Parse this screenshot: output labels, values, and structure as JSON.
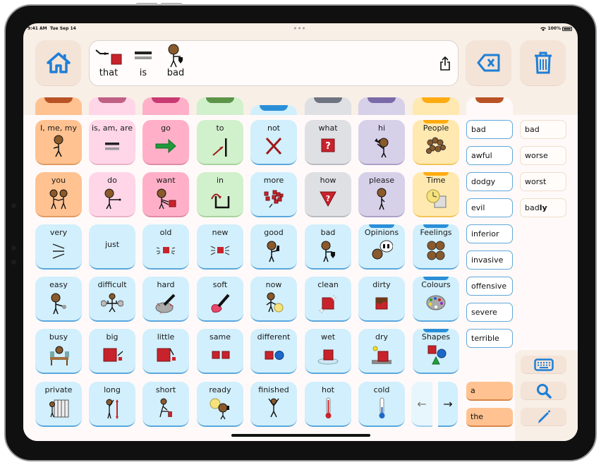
{
  "status_bar": {
    "time": "9:41 AM",
    "date": "Tue Sep 14",
    "dots": "•••",
    "wifi_icon": "wifi-icon",
    "battery": "100%"
  },
  "toolbar": {
    "home_icon": "home-icon",
    "share_icon": "share-icon",
    "backspace_icon": "backspace-icon",
    "clear_icon": "trash-icon"
  },
  "message": {
    "words": [
      {
        "label": "that",
        "symbol": "pointing-hand-square"
      },
      {
        "label": "is",
        "symbol": "equals"
      },
      {
        "label": "bad",
        "symbol": "person-thumbs-down"
      }
    ]
  },
  "colors": {
    "accent": "#1e7fd6",
    "tab_notches": [
      "#b95325",
      "#c06085",
      "#c93a72",
      "#5c9448",
      "#2b8fd8",
      "#6f7480",
      "#7a6aa8",
      "#ffab10",
      "#b95325"
    ],
    "tab_fills": [
      "#ffc290",
      "#ffd6e8",
      "#ffb0c8",
      "#d1f0cc",
      "#d1effc",
      "#dee0e4",
      "#d7d0e9",
      "#ffe9b0",
      "#fffaf9"
    ]
  },
  "grid": {
    "rows": [
      [
        {
          "label": "I, me, my",
          "color": "orange",
          "icon": "person-self"
        },
        {
          "label": "is, am, are",
          "color": "pink",
          "icon": "equals"
        },
        {
          "label": "go",
          "color": "rose",
          "icon": "green-arrow"
        },
        {
          "label": "to",
          "color": "green",
          "icon": "arrow-to-line"
        },
        {
          "label": "not",
          "color": "blue",
          "icon": "red-x"
        },
        {
          "label": "what",
          "color": "grey",
          "icon": "question-square"
        },
        {
          "label": "hi",
          "color": "purple",
          "icon": "person-waving"
        },
        {
          "label": "People",
          "color": "yellow",
          "icon": "people-group",
          "folder": true
        }
      ],
      [
        {
          "label": "you",
          "color": "orange",
          "icon": "two-people"
        },
        {
          "label": "do",
          "color": "pink",
          "icon": "person-pointing"
        },
        {
          "label": "want",
          "color": "rose",
          "icon": "person-reaching"
        },
        {
          "label": "in",
          "color": "green",
          "icon": "arrow-into-box"
        },
        {
          "label": "more",
          "color": "blue",
          "icon": "red-squares"
        },
        {
          "label": "how",
          "color": "grey",
          "icon": "question-triangle"
        },
        {
          "label": "please",
          "color": "purple",
          "icon": "person-please"
        },
        {
          "label": "Time",
          "color": "yellow",
          "icon": "clock-calendar",
          "folder": true
        }
      ],
      [
        {
          "label": "very",
          "color": "blue",
          "icon": "very-lines"
        },
        {
          "label": "just",
          "color": "blue",
          "icon": ""
        },
        {
          "label": "old",
          "color": "blue",
          "icon": "old-square"
        },
        {
          "label": "new",
          "color": "blue",
          "icon": "new-square"
        },
        {
          "label": "good",
          "color": "blue",
          "icon": "person-thumbs-up"
        },
        {
          "label": "bad",
          "color": "blue",
          "icon": "person-thumbs-down"
        },
        {
          "label": "Opinions",
          "color": "blue",
          "icon": "speech-thumbs",
          "folder": true
        },
        {
          "label": "Feelings",
          "color": "blue",
          "icon": "four-faces",
          "folder": true
        }
      ],
      [
        {
          "label": "easy",
          "color": "blue",
          "icon": "person-lifting-light"
        },
        {
          "label": "difficult",
          "color": "blue",
          "icon": "weightlifter"
        },
        {
          "label": "hard",
          "color": "blue",
          "icon": "hand-on-rock"
        },
        {
          "label": "soft",
          "color": "blue",
          "icon": "hand-on-cushion"
        },
        {
          "label": "now",
          "color": "blue",
          "icon": "person-clock"
        },
        {
          "label": "clean",
          "color": "blue",
          "icon": "sparkling-cube"
        },
        {
          "label": "dirty",
          "color": "blue",
          "icon": "dirty-cube"
        },
        {
          "label": "Colours",
          "color": "blue",
          "icon": "palette",
          "folder": true
        }
      ],
      [
        {
          "label": "busy",
          "color": "blue",
          "icon": "person-desk"
        },
        {
          "label": "big",
          "color": "blue",
          "icon": "big-square"
        },
        {
          "label": "little",
          "color": "blue",
          "icon": "little-square"
        },
        {
          "label": "same",
          "color": "blue",
          "icon": "two-squares"
        },
        {
          "label": "different",
          "color": "blue",
          "icon": "square-circle"
        },
        {
          "label": "wet",
          "color": "blue",
          "icon": "wet-cube"
        },
        {
          "label": "dry",
          "color": "blue",
          "icon": "dry-cube"
        },
        {
          "label": "Shapes",
          "color": "blue",
          "icon": "shapes",
          "folder": true
        }
      ],
      [
        {
          "label": "private",
          "color": "blue",
          "icon": "person-screen"
        },
        {
          "label": "long",
          "color": "blue",
          "icon": "person-tall"
        },
        {
          "label": "short",
          "color": "blue",
          "icon": "person-short"
        },
        {
          "label": "ready",
          "color": "blue",
          "icon": "clock-thumbs-up"
        },
        {
          "label": "finished",
          "color": "blue",
          "icon": "person-cheering"
        },
        {
          "label": "hot",
          "color": "blue",
          "icon": "thermometer-hot"
        },
        {
          "label": "cold",
          "color": "blue",
          "icon": "thermometer-cold"
        }
      ]
    ],
    "page_nav": {
      "prev": "←",
      "next": "→"
    }
  },
  "predictions": {
    "synonyms": [
      "bad",
      "awful",
      "dodgy",
      "evil",
      "inferior",
      "invasive",
      "offensive",
      "severe",
      "terrible"
    ],
    "forms": [
      {
        "base": "bad",
        "suffix": ""
      },
      {
        "base": "worse",
        "suffix": ""
      },
      {
        "base": "worst",
        "suffix": ""
      },
      {
        "base": "bad",
        "suffix": "ly"
      }
    ],
    "articles": [
      "a",
      "the"
    ]
  },
  "tray": {
    "keyboard_icon": "keyboard-icon",
    "search_icon": "search-icon",
    "pencil_icon": "pencil-icon"
  }
}
